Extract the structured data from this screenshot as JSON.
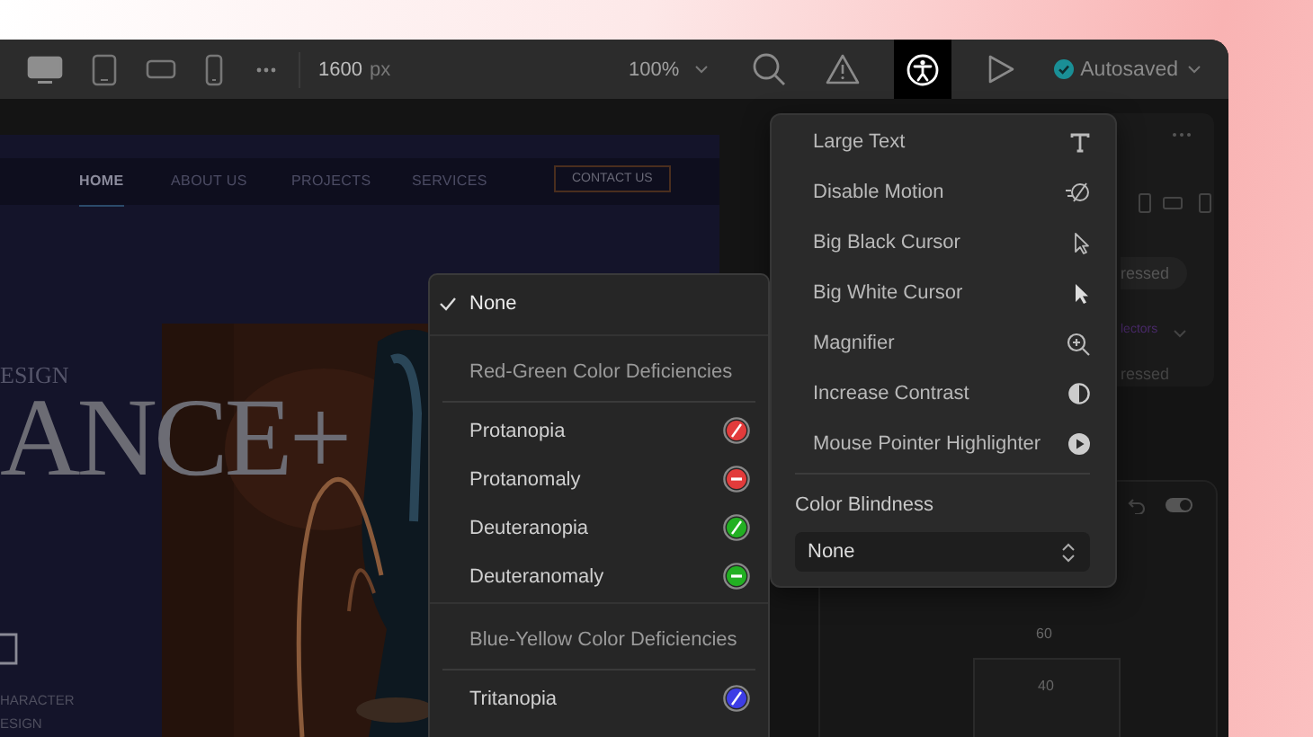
{
  "toolbar": {
    "devices": [
      {
        "selected": true
      },
      {
        "selected": false
      },
      {
        "selected": false
      },
      {
        "selected": false
      }
    ],
    "canvas_width": {
      "value": "1600",
      "unit": "px"
    },
    "zoom": "100%",
    "tools": [
      {
        "selected": false
      },
      {
        "selected": false
      },
      {
        "selected": true
      },
      {
        "selected": false
      }
    ],
    "status": "Autosaved"
  },
  "preview": {
    "nav": [
      {
        "label": "HOME",
        "selected": true
      },
      {
        "label": "ABOUT US",
        "selected": false
      },
      {
        "label": "PROJECTS",
        "selected": false
      },
      {
        "label": "SERVICES",
        "selected": false
      }
    ],
    "contact_button": "CONTACT US",
    "eyebrow": "ESIGN",
    "headline": "ANCE+",
    "caption_lines": [
      "HARACTER",
      "ESIGN"
    ]
  },
  "side_panel": {
    "state_pill": "ressed",
    "selectors": "lectors",
    "state_label": "ressed",
    "toggle_on": true,
    "spacing": [
      "60",
      "40"
    ]
  },
  "accessibility_menu": {
    "items": [
      {
        "label": "Large Text"
      },
      {
        "label": "Disable Motion"
      },
      {
        "label": "Big Black Cursor"
      },
      {
        "label": "Big White Cursor"
      },
      {
        "label": "Magnifier"
      },
      {
        "label": "Increase Contrast"
      },
      {
        "label": "Mouse Pointer Highlighter"
      }
    ],
    "color_blindness": {
      "label": "Color Blindness",
      "value": "None"
    }
  },
  "color_blindness_list": [
    {
      "kind": "plain",
      "label": "None",
      "selected": true
    },
    {
      "kind": "header",
      "label": "Red-Green Color Deficiencies"
    },
    {
      "kind": "slash",
      "label": "Protanopia",
      "selected": false,
      "color": "#e23b3b"
    },
    {
      "kind": "minus",
      "label": "Protanomaly",
      "selected": false,
      "color": "#e23b3b"
    },
    {
      "kind": "slash",
      "label": "Deuteranopia",
      "selected": false,
      "color": "#22b022"
    },
    {
      "kind": "minus",
      "label": "Deuteranomaly",
      "selected": false,
      "color": "#22b022"
    },
    {
      "kind": "header",
      "label": "Blue-Yellow Color Deficiencies"
    },
    {
      "kind": "slash",
      "label": "Tritanopia",
      "selected": false,
      "color": "#3d3de6"
    }
  ]
}
